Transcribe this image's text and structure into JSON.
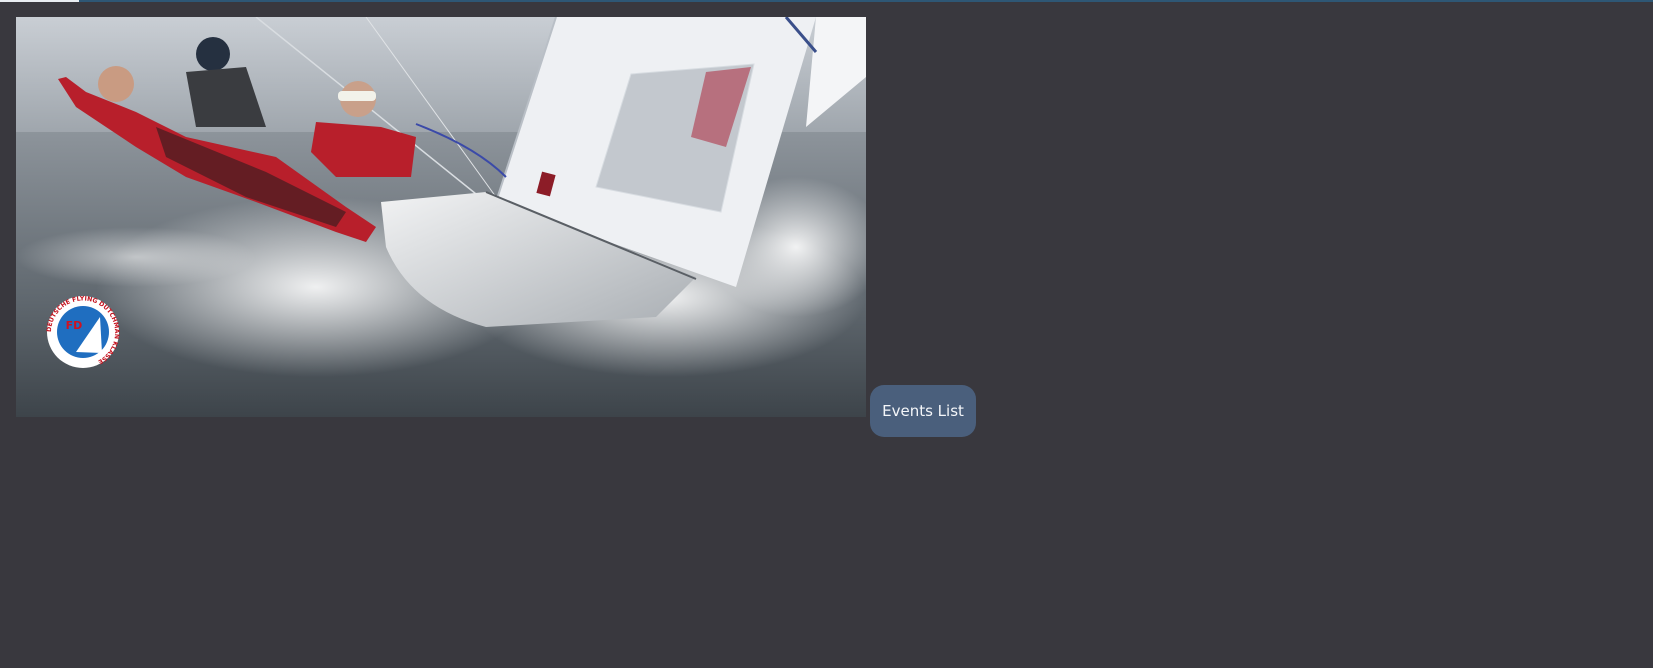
{
  "page": {
    "background": "#39383e"
  },
  "top_bar": {
    "color": "#2e5775",
    "progress_color": "#e9edf1",
    "progress_fraction": 0.048
  },
  "hero": {
    "logo": {
      "text": "DEUTSCHE FLYING DUTCHMAN KLASSE",
      "monogram": "FD"
    }
  },
  "events_button": {
    "label": "Events List",
    "background": "#4a5f7c"
  }
}
